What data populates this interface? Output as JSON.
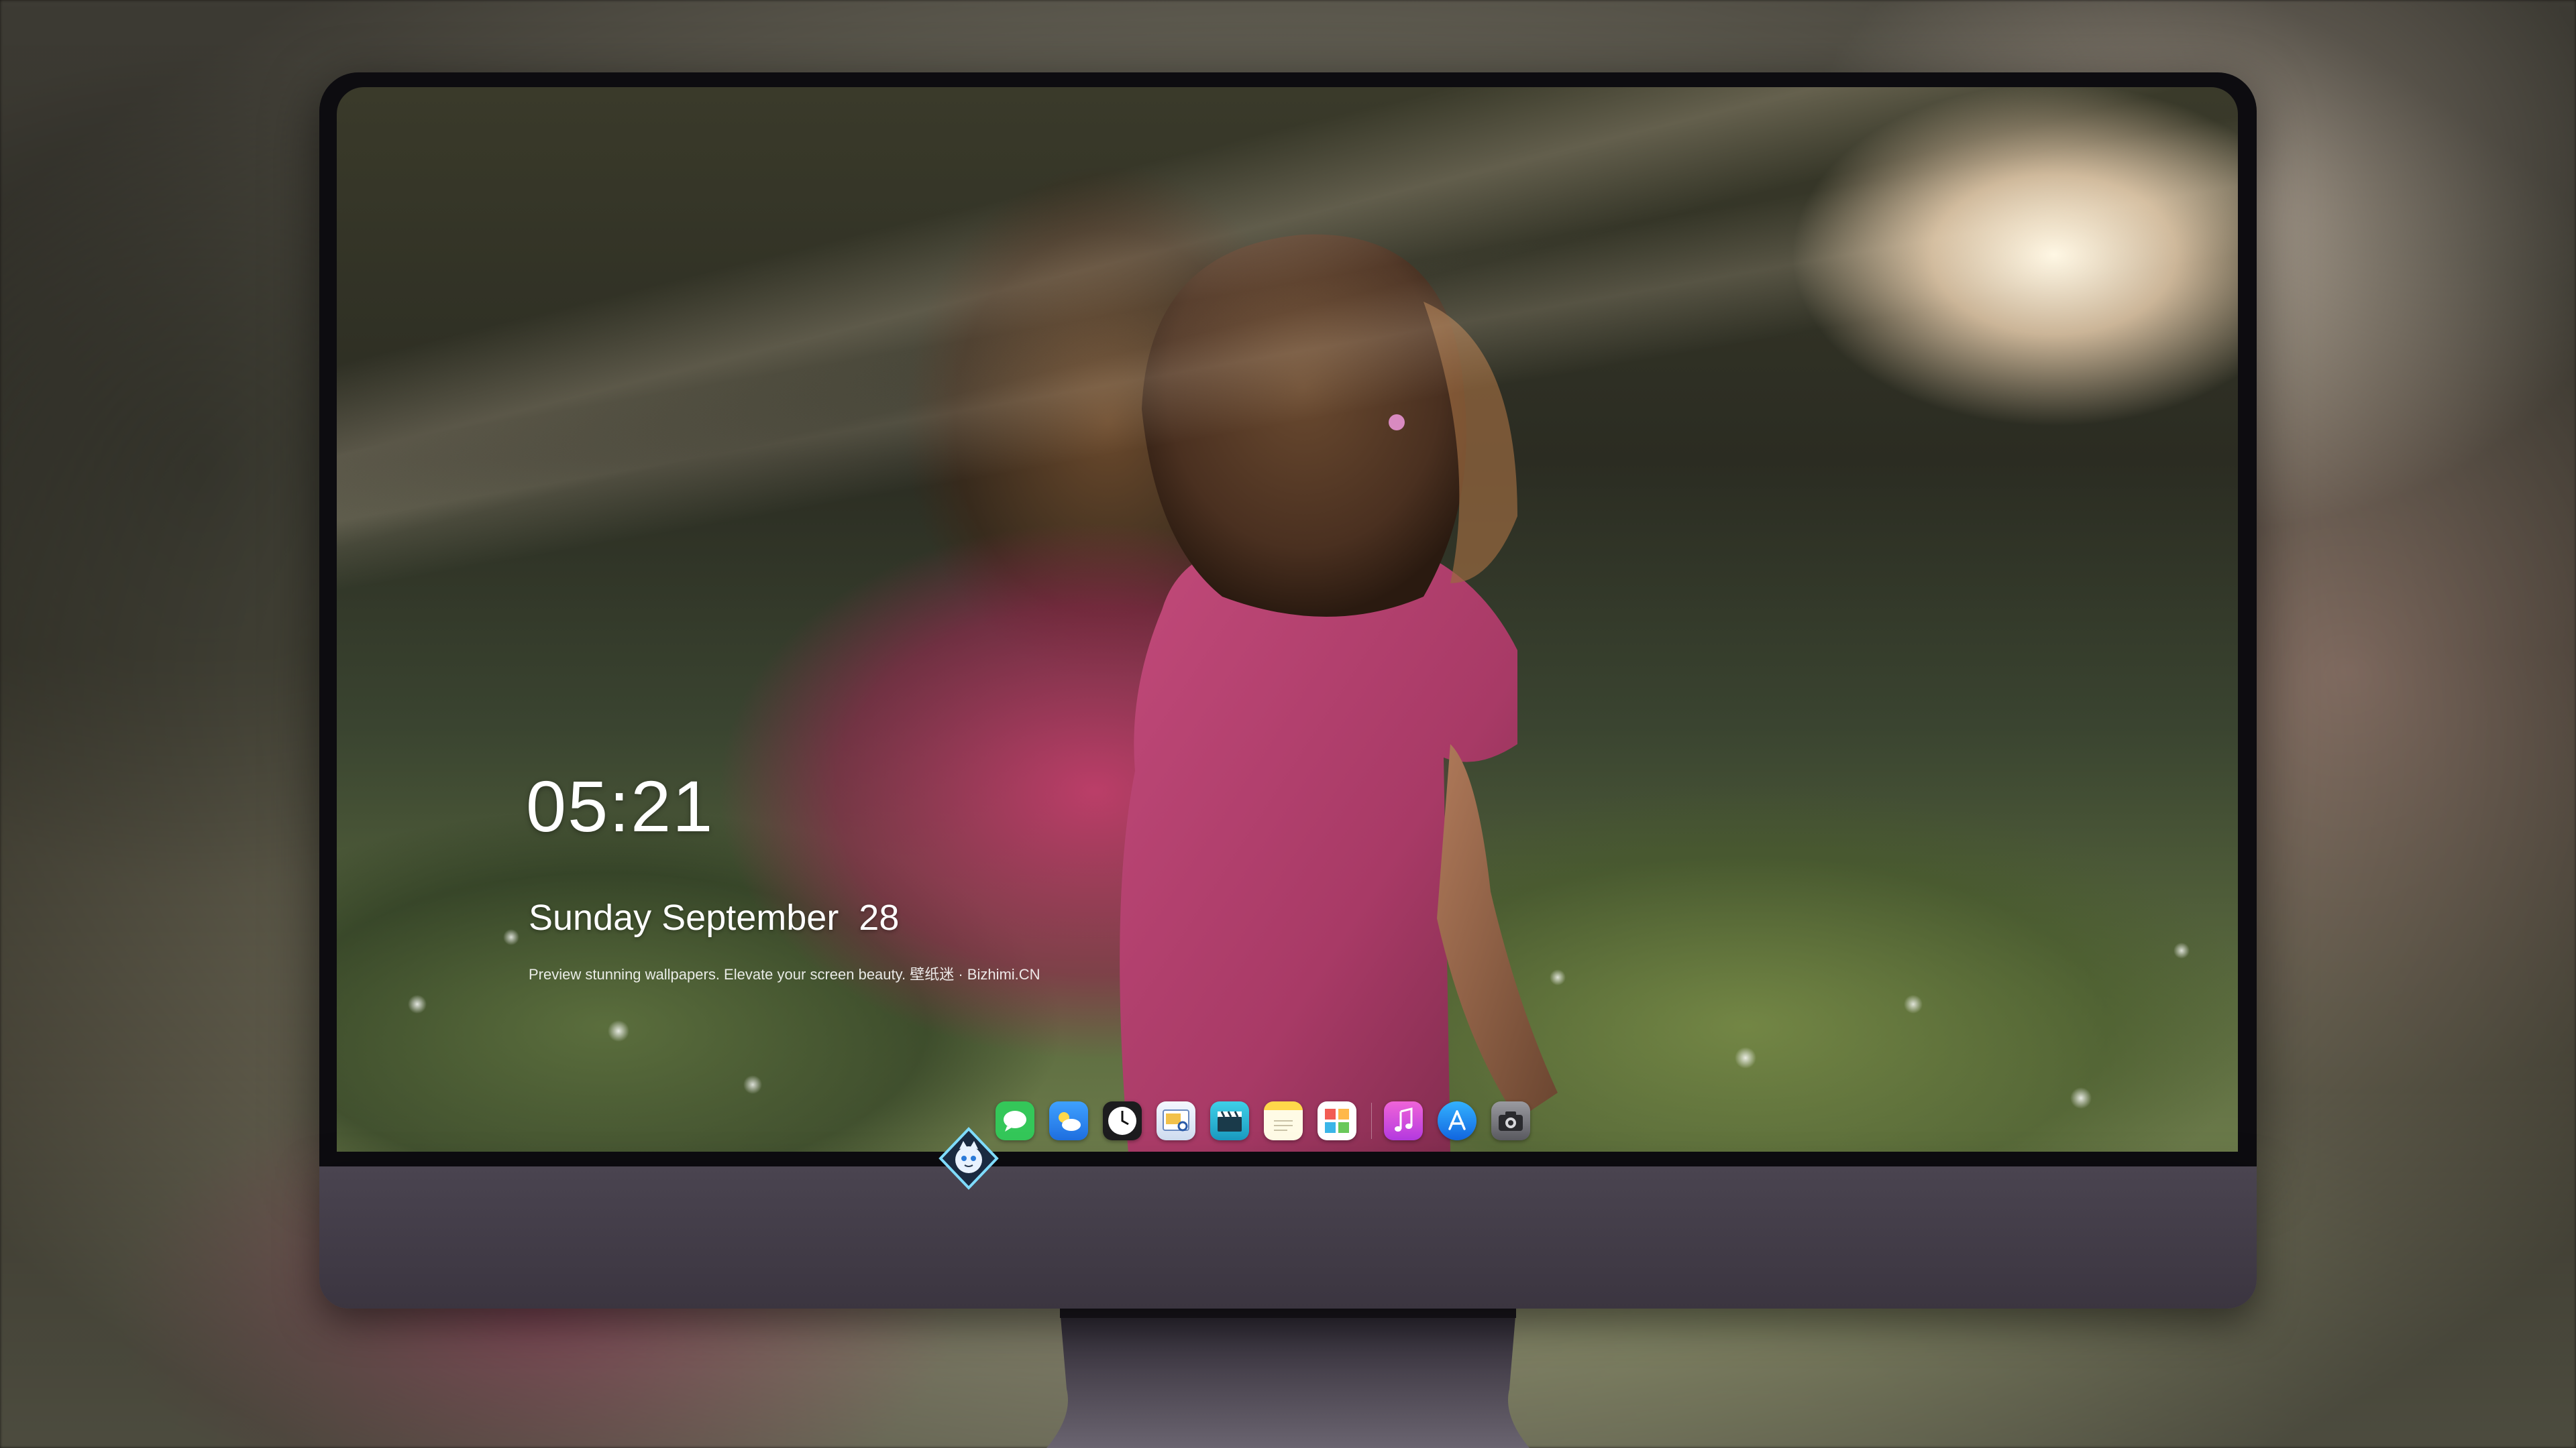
{
  "lockscreen": {
    "time": "05:21",
    "date": "Sunday September  28",
    "tagline": "Preview stunning wallpapers. Elevate your screen beauty. 壁纸迷 · Bizhimi.CN"
  },
  "dock": {
    "items": [
      {
        "name": "messages",
        "icon": "message-icon",
        "color": "#34c759"
      },
      {
        "name": "weather",
        "icon": "weather-icon",
        "color": "#2f8cff"
      },
      {
        "name": "clock",
        "icon": "clock-icon",
        "color": "#ffffff"
      },
      {
        "name": "preview",
        "icon": "preview-icon",
        "color": "#e8f0ff"
      },
      {
        "name": "video",
        "icon": "clapperboard-icon",
        "color": "#29b6d6"
      },
      {
        "name": "notes",
        "icon": "notes-icon",
        "color": "#fff2a8"
      },
      {
        "name": "photos",
        "icon": "photos-icon",
        "color": "#ffffff"
      },
      {
        "name": "music",
        "icon": "music-note-icon",
        "color": "#d74be8"
      },
      {
        "name": "app-store",
        "icon": "app-store-icon",
        "color": "#1b8cff"
      },
      {
        "name": "camera",
        "icon": "camera-icon",
        "color": "#8a8a8f"
      }
    ]
  },
  "colors": {
    "monitor_chin": "#3b3540",
    "bezel": "#0d0c10"
  }
}
